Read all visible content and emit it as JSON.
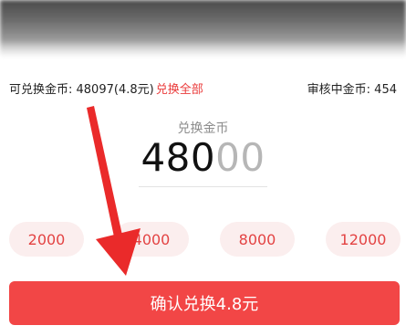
{
  "coins": {
    "exchangeable_label": "可兑换金币: 48097(4.8元)",
    "exchange_all_label": "兑换全部",
    "reviewing_label": "审核中金币: 454"
  },
  "amount": {
    "label": "兑换金币",
    "entered": "480",
    "placeholder_tail": "00"
  },
  "quick_amounts": [
    "2000",
    "4000",
    "8000",
    "12000"
  ],
  "confirm_button": {
    "label": "确认兑换4.8元"
  },
  "colors": {
    "accent": "#f24646",
    "chip_bg": "#fbeeee",
    "chip_text": "#e34343",
    "link_red": "#ea3a3a"
  }
}
